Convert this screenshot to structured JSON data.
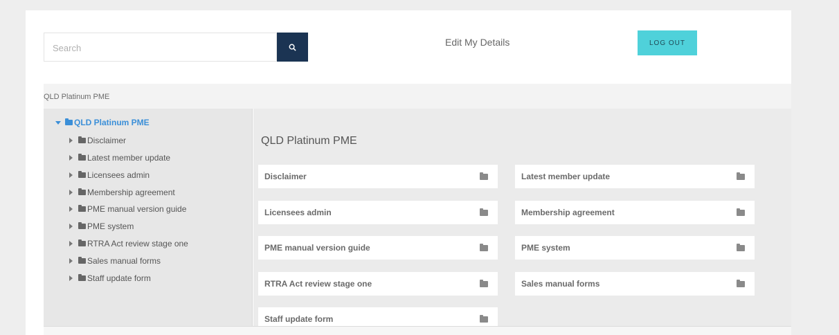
{
  "header": {
    "search_placeholder": "Search",
    "search_icon": "search-icon",
    "edit_details_label": "Edit My Details",
    "logout_label": "LOG OUT"
  },
  "panel": {
    "breadcrumb": "QLD Platinum PME"
  },
  "tree": {
    "root": {
      "label": "QLD Platinum PME",
      "icon": "folder-icon",
      "expanded": true
    },
    "items": [
      {
        "label": "Disclaimer"
      },
      {
        "label": "Latest member update"
      },
      {
        "label": "Licensees admin"
      },
      {
        "label": "Membership agreement"
      },
      {
        "label": "PME manual version guide"
      },
      {
        "label": "PME system"
      },
      {
        "label": "RTRA Act review stage one"
      },
      {
        "label": "Sales manual forms"
      },
      {
        "label": "Staff update form"
      }
    ]
  },
  "content": {
    "title": "QLD Platinum PME",
    "cards": [
      {
        "label": "Disclaimer"
      },
      {
        "label": "Latest member update"
      },
      {
        "label": "Licensees admin"
      },
      {
        "label": "Membership agreement"
      },
      {
        "label": "PME manual version guide"
      },
      {
        "label": "PME system"
      },
      {
        "label": "RTRA Act review stage one"
      },
      {
        "label": "Sales manual forms"
      },
      {
        "label": "Staff update form"
      }
    ]
  },
  "colors": {
    "brand_dark": "#1b3453",
    "accent_teal": "#4fd1da",
    "tree_link": "#3b8fd8"
  }
}
